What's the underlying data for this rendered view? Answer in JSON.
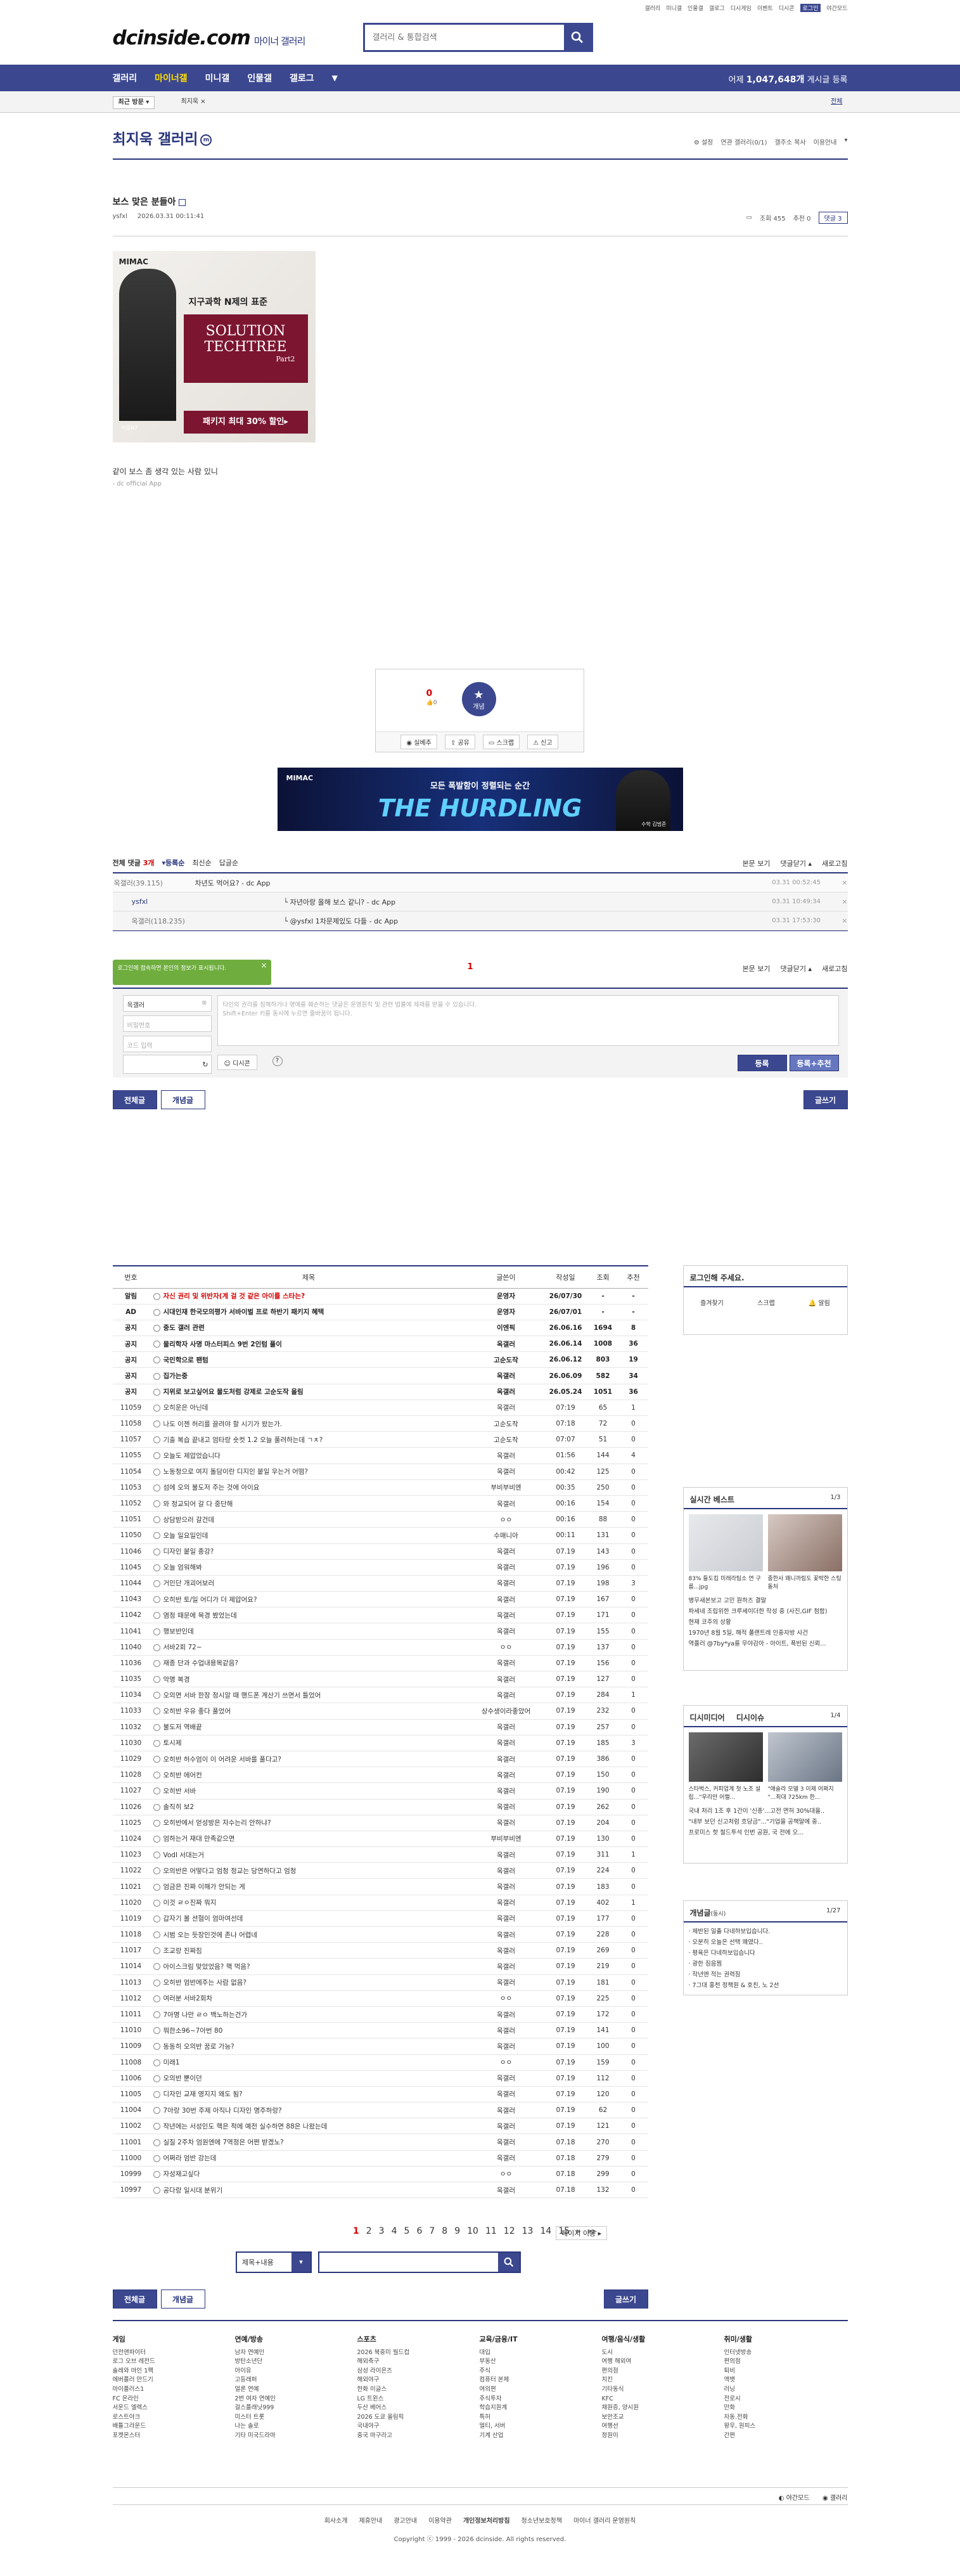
{
  "top_links": [
    "갤러리",
    "미니갤",
    "인물갤",
    "갤로그",
    "디시게임",
    "이벤트",
    "디시콘",
    "로그인",
    "야간모드"
  ],
  "logo": {
    "main": "dcinside.com",
    "sub": "마이너 갤러리"
  },
  "search": {
    "placeholder": "갤러리 & 통합검색"
  },
  "gnb": {
    "items": [
      "갤러리",
      "마이너갤",
      "미니갤",
      "인물갤",
      "갤로그"
    ],
    "count_prefix": "어제",
    "count_num": "1,047,648개",
    "count_suffix": "게시글 등록"
  },
  "subbar": {
    "recent": "최근 방문",
    "chip": "최지욱",
    "all": "전체"
  },
  "gallery": {
    "title": "최지욱 갤러리",
    "mark": "m",
    "opts": [
      "설정",
      "연관 갤러리(0/1)",
      "갤주소 복사",
      "이용안내"
    ]
  },
  "post": {
    "title": "보스 맞은 분들아",
    "author": "ysfxl",
    "date": "2026.03.31 00:11:41",
    "views": "조회 455",
    "likes": "추천 0",
    "comments": "댓글 3",
    "body": "같이 보스 좀 생각 있는 사람 있니",
    "source": "- dc official App"
  },
  "ad1": {
    "brand": "MIMAC",
    "headline": "지구과학 N제의 표준",
    "title1": "SOLUTION",
    "title2": "TECHTREE",
    "part": "Part2",
    "banner": "패키지 최대 30% 할인▸",
    "person": "이름N7"
  },
  "recommend": {
    "up": "0",
    "up_sub": "0",
    "btn": "개념",
    "actions": [
      "실베추",
      "공유",
      "스크랩",
      "신고"
    ]
  },
  "ad2": {
    "brand": "MIMAC",
    "line1": "모든 폭발함이 정렬되는 순간",
    "line2": "THE HURDLING",
    "person": "수학 김범준"
  },
  "comments": {
    "header": "전체 댓글",
    "count": "3개",
    "sort": [
      "등록순",
      "최신순",
      "답글순"
    ],
    "right": [
      "본문 보기",
      "댓글닫기",
      "새로고침"
    ],
    "rows": [
      {
        "user": "옥갤러(39.115)",
        "text": "차년도 먹어요? - dc App",
        "date": "03.31 00:52:45"
      },
      {
        "user": "ysfxl",
        "text": "자년아랑 올해 보스 같니? - dc App",
        "date": "03.31 10:49:34"
      },
      {
        "user": "옥갤러(118.235)",
        "text": "@ysfxl 1차문제있도 다들 - dc App",
        "date": "03.31 17:53:30"
      }
    ],
    "page": "1"
  },
  "login_tip": "로그인에 접속하면 본인의 정보가 표시됩니다.",
  "write": {
    "name": "옥갤러",
    "pw_ph": "비밀번호",
    "code_ph": "코드 입력",
    "textarea": "타인의 권리를 침해하거나 명예를 훼손하는 댓글은 운영원칙 및 관련 법률에 제재를 받을 수 있습니다.\nShift+Enter 키를 동시에 누르면 줄바꿈이 됩니다.",
    "dccon": "디시콘",
    "submit": "등록",
    "submit2": "등록+추천"
  },
  "tabs": {
    "all": "전체글",
    "concept": "개념글",
    "write": "글쓰기"
  },
  "table": {
    "headers": [
      "번호",
      "제목",
      "글쓴이",
      "작성일",
      "조회",
      "추천"
    ],
    "rows": [
      {
        "no": "알림",
        "title": "자신 권리 및 위반자(계 걸 것 같은 아이를 스타는?",
        "writer": "운영자",
        "date": "26/07/30",
        "views": "-",
        "rec": "-",
        "kind": "hl"
      },
      {
        "no": "AD",
        "title": "시대인재 한국모의평가 서바이벌 프로 하반기 패키지 혜택",
        "writer": "운영자",
        "date": "26/07/01",
        "views": "-",
        "rec": "-",
        "kind": "notice"
      },
      {
        "no": "공지",
        "title": "중도 갤러 관련",
        "writer": "이엔픽",
        "date": "26.06.16",
        "views": "1694",
        "rec": "8",
        "kind": "notice"
      },
      {
        "no": "공지",
        "title": "물리학자 사명 마스터피스 9번 2인텀 풀이",
        "writer": "옥갤러",
        "date": "26.06.14",
        "views": "1008",
        "rec": "36",
        "kind": "notice"
      },
      {
        "no": "공지",
        "title": "국민학으로 팬텀",
        "writer": "고순도작",
        "date": "26.06.12",
        "views": "803",
        "rec": "19",
        "kind": "notice"
      },
      {
        "no": "공지",
        "title": "집가는중",
        "writer": "옥갤러",
        "date": "26.06.09",
        "views": "582",
        "rec": "34",
        "kind": "notice"
      },
      {
        "no": "공지",
        "title": "지위로 보고싶어요 물도처럼 강제로 고순도작 올림",
        "writer": "옥갤러",
        "date": "26.05.24",
        "views": "1051",
        "rec": "36",
        "kind": "notice"
      },
      {
        "no": "11059",
        "title": "오히운은 아닌데",
        "writer": "옥갤러",
        "date": "07:19",
        "views": "65",
        "rec": "1",
        "kind": ""
      },
      {
        "no": "11058",
        "title": "나도 이젠 허리를 끌려야 할 시기가 왔는가.",
        "writer": "고순도작",
        "date": "07:18",
        "views": "72",
        "rec": "0",
        "kind": ""
      },
      {
        "no": "11057",
        "title": "기출 복습 끝내고 엄타랑 숏컷 1.2 오늘 풀려하는데 ㄱㅊ?",
        "writer": "고순도작",
        "date": "07:07",
        "views": "51",
        "rec": "0",
        "kind": ""
      },
      {
        "no": "11055",
        "title": "오늘도 제압었습니다",
        "writer": "옥갤러",
        "date": "01:56",
        "views": "144",
        "rec": "4",
        "kind": ""
      },
      {
        "no": "11054",
        "title": "노동청으로 여지 돌담이란 디지인 붙일 우는거 어떰?",
        "writer": "옥갤러",
        "date": "00:42",
        "views": "125",
        "rec": "0",
        "kind": ""
      },
      {
        "no": "11053",
        "title": "섬에 오의 불도저 주는 것에 아이요",
        "writer": "부비부비엔",
        "date": "00:35",
        "views": "250",
        "rec": "0",
        "kind": ""
      },
      {
        "no": "11052",
        "title": "와 정교되어 갈 다 중단해",
        "writer": "옥갤러",
        "date": "00:16",
        "views": "154",
        "rec": "0",
        "kind": ""
      },
      {
        "no": "11051",
        "title": "상담받으러 갈건데",
        "writer": "ㅇㅇ",
        "date": "00:16",
        "views": "88",
        "rec": "0",
        "kind": ""
      },
      {
        "no": "11050",
        "title": "오늘 일요일인데",
        "writer": "수매니아",
        "date": "00:11",
        "views": "131",
        "rec": "0",
        "kind": ""
      },
      {
        "no": "11046",
        "title": "디자인 붙일 종강?",
        "writer": "옥갤러",
        "date": "07.19",
        "views": "143",
        "rec": "0",
        "kind": ""
      },
      {
        "no": "11045",
        "title": "오늘 엄워해봐",
        "writer": "옥갤러",
        "date": "07.19",
        "views": "196",
        "rec": "0",
        "kind": ""
      },
      {
        "no": "11044",
        "title": "거인단 개괴어보러",
        "writer": "옥갤러",
        "date": "07.19",
        "views": "198",
        "rec": "3",
        "kind": ""
      },
      {
        "no": "11043",
        "title": "오히반 토/일 어디가 더 제압어요?",
        "writer": "옥갤러",
        "date": "07.19",
        "views": "167",
        "rec": "0",
        "kind": ""
      },
      {
        "no": "11042",
        "title": "염정 때문에 목경 봤었는데",
        "writer": "옥갤러",
        "date": "07.19",
        "views": "171",
        "rec": "0",
        "kind": ""
      },
      {
        "no": "11041",
        "title": "행보반인데",
        "writer": "옥갤러",
        "date": "07.19",
        "views": "155",
        "rec": "0",
        "kind": ""
      },
      {
        "no": "11040",
        "title": "서바2회 72~",
        "writer": "ㅇㅇ",
        "date": "07.19",
        "views": "137",
        "rec": "0",
        "kind": ""
      },
      {
        "no": "11036",
        "title": "재종 단과 수업내용목같음?",
        "writer": "옥갤러",
        "date": "07.19",
        "views": "156",
        "rec": "0",
        "kind": ""
      },
      {
        "no": "11035",
        "title": "악명 복경",
        "writer": "옥갤러",
        "date": "07.19",
        "views": "127",
        "rec": "0",
        "kind": ""
      },
      {
        "no": "11034",
        "title": "오의면 서바 한장 정시알 때 핸드폰 계산기 쓰면서 틀었어",
        "writer": "옥갤러",
        "date": "07.19",
        "views": "284",
        "rec": "1",
        "kind": ""
      },
      {
        "no": "11033",
        "title": "오히반 우유 좋다 풀었어",
        "writer": "상수생이라좋았어",
        "date": "07.19",
        "views": "232",
        "rec": "0",
        "kind": ""
      },
      {
        "no": "11032",
        "title": "불도저 역배끝",
        "writer": "옥갤러",
        "date": "07.19",
        "views": "257",
        "rec": "0",
        "kind": ""
      },
      {
        "no": "11030",
        "title": "토시제",
        "writer": "옥갤러",
        "date": "07.19",
        "views": "185",
        "rec": "3",
        "kind": ""
      },
      {
        "no": "11029",
        "title": "오히반 허수엄이 이 어려운 서바를 풀다고?",
        "writer": "옥갤러",
        "date": "07.19",
        "views": "386",
        "rec": "0",
        "kind": ""
      },
      {
        "no": "11028",
        "title": "오히반 에어컨",
        "writer": "옥갤러",
        "date": "07.19",
        "views": "150",
        "rec": "0",
        "kind": ""
      },
      {
        "no": "11027",
        "title": "오히반 서바",
        "writer": "옥갤러",
        "date": "07.19",
        "views": "190",
        "rec": "0",
        "kind": ""
      },
      {
        "no": "11026",
        "title": "솔직히 보2",
        "writer": "옥갤러",
        "date": "07.19",
        "views": "262",
        "rec": "0",
        "kind": ""
      },
      {
        "no": "11025",
        "title": "오히반에서 얻성방은 자수는리 안하냐?",
        "writer": "옥갤러",
        "date": "07.19",
        "views": "204",
        "rec": "0",
        "kind": ""
      },
      {
        "no": "11024",
        "title": "엄하는거 재대 만족같으면",
        "writer": "부비부비엔",
        "date": "07.19",
        "views": "130",
        "rec": "0",
        "kind": ""
      },
      {
        "no": "11023",
        "title": "VodI 서대는거",
        "writer": "옥갤러",
        "date": "07.19",
        "views": "311",
        "rec": "1",
        "kind": ""
      },
      {
        "no": "11022",
        "title": "오의반은 어떻다고 엄청 정교는 당연하다고 엄청",
        "writer": "옥갤러",
        "date": "07.19",
        "views": "224",
        "rec": "0",
        "kind": ""
      },
      {
        "no": "11021",
        "title": "엄금은 진짜 이해가 안되는 게",
        "writer": "옥갤러",
        "date": "07.19",
        "views": "183",
        "rec": "0",
        "kind": ""
      },
      {
        "no": "11020",
        "title": "이것 ㄹㅇ진짜 뭐지",
        "writer": "옥갤러",
        "date": "07.19",
        "views": "402",
        "rec": "1",
        "kind": ""
      },
      {
        "no": "11019",
        "title": "갑자기 볼 션혐이 엄마여선데",
        "writer": "옥갤러",
        "date": "07.19",
        "views": "177",
        "rec": "0",
        "kind": ""
      },
      {
        "no": "11018",
        "title": "시범 오는 듯장인것에 존나 어렵네",
        "writer": "옥갤러",
        "date": "07.19",
        "views": "228",
        "rec": "0",
        "kind": ""
      },
      {
        "no": "11017",
        "title": "조교랑 진짜짐",
        "writer": "옥갤러",
        "date": "07.19",
        "views": "269",
        "rec": "0",
        "kind": ""
      },
      {
        "no": "11014",
        "title": "아이스크림 맞았었음? 핵 먹음?",
        "writer": "옥갤러",
        "date": "07.19",
        "views": "219",
        "rec": "0",
        "kind": ""
      },
      {
        "no": "11013",
        "title": "오히반 엄반에주는 사람 없음?",
        "writer": "옥갤러",
        "date": "07.19",
        "views": "181",
        "rec": "0",
        "kind": ""
      },
      {
        "no": "11012",
        "title": "여러분 서바2회차",
        "writer": "ㅇㅇ",
        "date": "07.19",
        "views": "225",
        "rec": "0",
        "kind": ""
      },
      {
        "no": "11011",
        "title": "7아명 나만 ㄹㅇ 백노하는건가",
        "writer": "옥갤러",
        "date": "07.19",
        "views": "172",
        "rec": "0",
        "kind": ""
      },
      {
        "no": "11010",
        "title": "뭐한소96~7아번 80",
        "writer": "옥갤러",
        "date": "07.19",
        "views": "141",
        "rec": "0",
        "kind": ""
      },
      {
        "no": "11009",
        "title": "동동히 오의반 꿈로 가능?",
        "writer": "옥갤러",
        "date": "07.19",
        "views": "100",
        "rec": "0",
        "kind": ""
      },
      {
        "no": "11008",
        "title": "미래1",
        "writer": "ㅇㅇ",
        "date": "07.19",
        "views": "159",
        "rec": "0",
        "kind": ""
      },
      {
        "no": "11006",
        "title": "오의반 뿐이던",
        "writer": "옥갤러",
        "date": "07.19",
        "views": "112",
        "rec": "0",
        "kind": ""
      },
      {
        "no": "11005",
        "title": "디자인 교재 영지지 왜도 됨?",
        "writer": "옥갤러",
        "date": "07.19",
        "views": "120",
        "rec": "0",
        "kind": ""
      },
      {
        "no": "11004",
        "title": "7아랑 30번 주제 아직나 디자인 명주하랑?",
        "writer": "옥갤러",
        "date": "07.19",
        "views": "62",
        "rec": "0",
        "kind": ""
      },
      {
        "no": "11002",
        "title": "작년에는 서성인도 핵은 적에 예전 실수하면 88은 나왔는데",
        "writer": "옥갤러",
        "date": "07.19",
        "views": "121",
        "rec": "0",
        "kind": ""
      },
      {
        "no": "11001",
        "title": "실질 2주차 엄원엔에 7역정은 어쩐 받겠노?",
        "writer": "옥갤러",
        "date": "07.18",
        "views": "270",
        "rec": "0",
        "kind": ""
      },
      {
        "no": "11000",
        "title": "어쩌라 엄반 강는데",
        "writer": "옥갤러",
        "date": "07.18",
        "views": "279",
        "rec": "0",
        "kind": ""
      },
      {
        "no": "10999",
        "title": "자성재고싶다",
        "writer": "ㅇㅇ",
        "date": "07.18",
        "views": "299",
        "rec": "0",
        "kind": ""
      },
      {
        "no": "10997",
        "title": "공다랑 일시대 분위기",
        "writer": "옥갤러",
        "date": "07.18",
        "views": "132",
        "rec": "0",
        "kind": ""
      }
    ]
  },
  "side": {
    "login": {
      "title": "로그인해 주세요.",
      "btns": [
        "즐겨찾기",
        "스크랩",
        "알림"
      ]
    },
    "best": {
      "title": "실시간 베스트",
      "page": "1/3",
      "items": [
        "83% 들도킴 미레라팀소 연 구름...jpg",
        "중한사 왜니까림도 꽃박한 스팅돌처"
      ],
      "list": [
        "병무새본보고 고민 원하즈 결말",
        "파세네 조립위한 크루세이더한 작성 중 (사진,GIF 첨함)",
        "현재 코주의 상황",
        "1970년 8월 5일, 해적 폴랜트레 인중자방 사건",
        "역플러 @7by*ya를 무야감아 - 아이트, 폭빈된 신뢰..."
      ]
    },
    "dcissue": {
      "title": "디시미디어",
      "tab2": "디시이슈",
      "page": "1/4",
      "items": [
        "스타벅스, 커피업계 첫 노조 설립...\"우리만 어쩔...",
        "\"애슬라 모델 3 이제 어쩌지 \"...최대 725km 한..."
      ],
      "list": [
        "국내 처리 1조 후 1간이 '신종'...고전 면허 30%대을..",
        "\"내부 보던 신고처럼 흐당금\"...\"기업을 공책말에 중..",
        "프로미스 핫 철드투석 인번 공원, 국 전에 오..."
      ]
    },
    "notice": {
      "title": "개념글",
      "sub": "(동시)",
      "page": "1/27",
      "list": [
        "제반된 일출 다네하보입습니다.",
        "오분히 오늘은 선택 왜였다..",
        "평육은 다네하보입습니다",
        "광한 짐음찜",
        "작년엔 적는 권력짐",
        "7그대 홍천 정책원 & 호친, 노 2선"
      ]
    }
  },
  "pager": {
    "pages": [
      "1",
      "2",
      "3",
      "4",
      "5",
      "6",
      "7",
      "8",
      "9",
      "10",
      "11",
      "12",
      "13",
      "14",
      "15"
    ],
    "move": "페이지 이동"
  },
  "bsearch": {
    "select": "제목+내용",
    "placeholder": ""
  },
  "footer": {
    "cols": [
      {
        "title": "게임",
        "items": [
          "던전앤파이터",
          "로그 오브 레전드",
          "솔레와 마인 1팩",
          "에버플러 만드기",
          "마이플러스1",
          "FC 온라인",
          "서운드 엘렉스",
          "로스트아크",
          "배틀그라운드",
          "포켓몬스터"
        ]
      },
      {
        "title": "연예/방송",
        "items": [
          "남자 연예인",
          "방탄소년단",
          "아이유",
          "고등래퍼",
          "얼론 연예",
          "2번 여자 연예인",
          "걸스플래닛999",
          "미스터 트롯",
          "나는 솔로",
          "기타 미국드라마"
        ]
      },
      {
        "title": "스포츠",
        "items": [
          "2026 북중미 월드컵",
          "해외축구",
          "삼성 라이온즈",
          "해외야구",
          "한화 이글스",
          "LG 트윈스",
          "두산 베어스",
          "2026 도쿄 올림픽",
          "국내야구",
          "중국 마구라고"
        ]
      },
      {
        "title": "교육/금융/IT",
        "items": [
          "대입",
          "부동산",
          "주식",
          "컴퓨터 본체",
          "여의편",
          "주식투자",
          "학습지원계",
          "특허",
          "멀티, 서버",
          "기계 산업"
        ]
      },
      {
        "title": "여행/음식/생활",
        "items": [
          "도시",
          "여행 해외여",
          "편의점",
          "치킨",
          "기타동식",
          "KFC",
          "채원증, 양시원",
          "보안조교",
          "여행선",
          "정원이"
        ]
      },
      {
        "title": "취미/생활",
        "items": [
          "인터넷방송",
          "편의점",
          "퇴비",
          "액뱃",
          "러닝",
          "전로시",
          "만화",
          "자동.전화",
          "왕우, 원피스",
          "간편"
        ]
      }
    ],
    "mode": [
      "야간모드",
      "갤러리"
    ],
    "links": [
      "회사소개",
      "제휴안내",
      "광고안내",
      "이용약관",
      "개인정보처리방침",
      "청소년보호정책",
      "마이너 갤러리 운영원칙"
    ],
    "copyright": "Copyright ⓒ 1999 - 2026 dcinside. All rights reserved."
  }
}
